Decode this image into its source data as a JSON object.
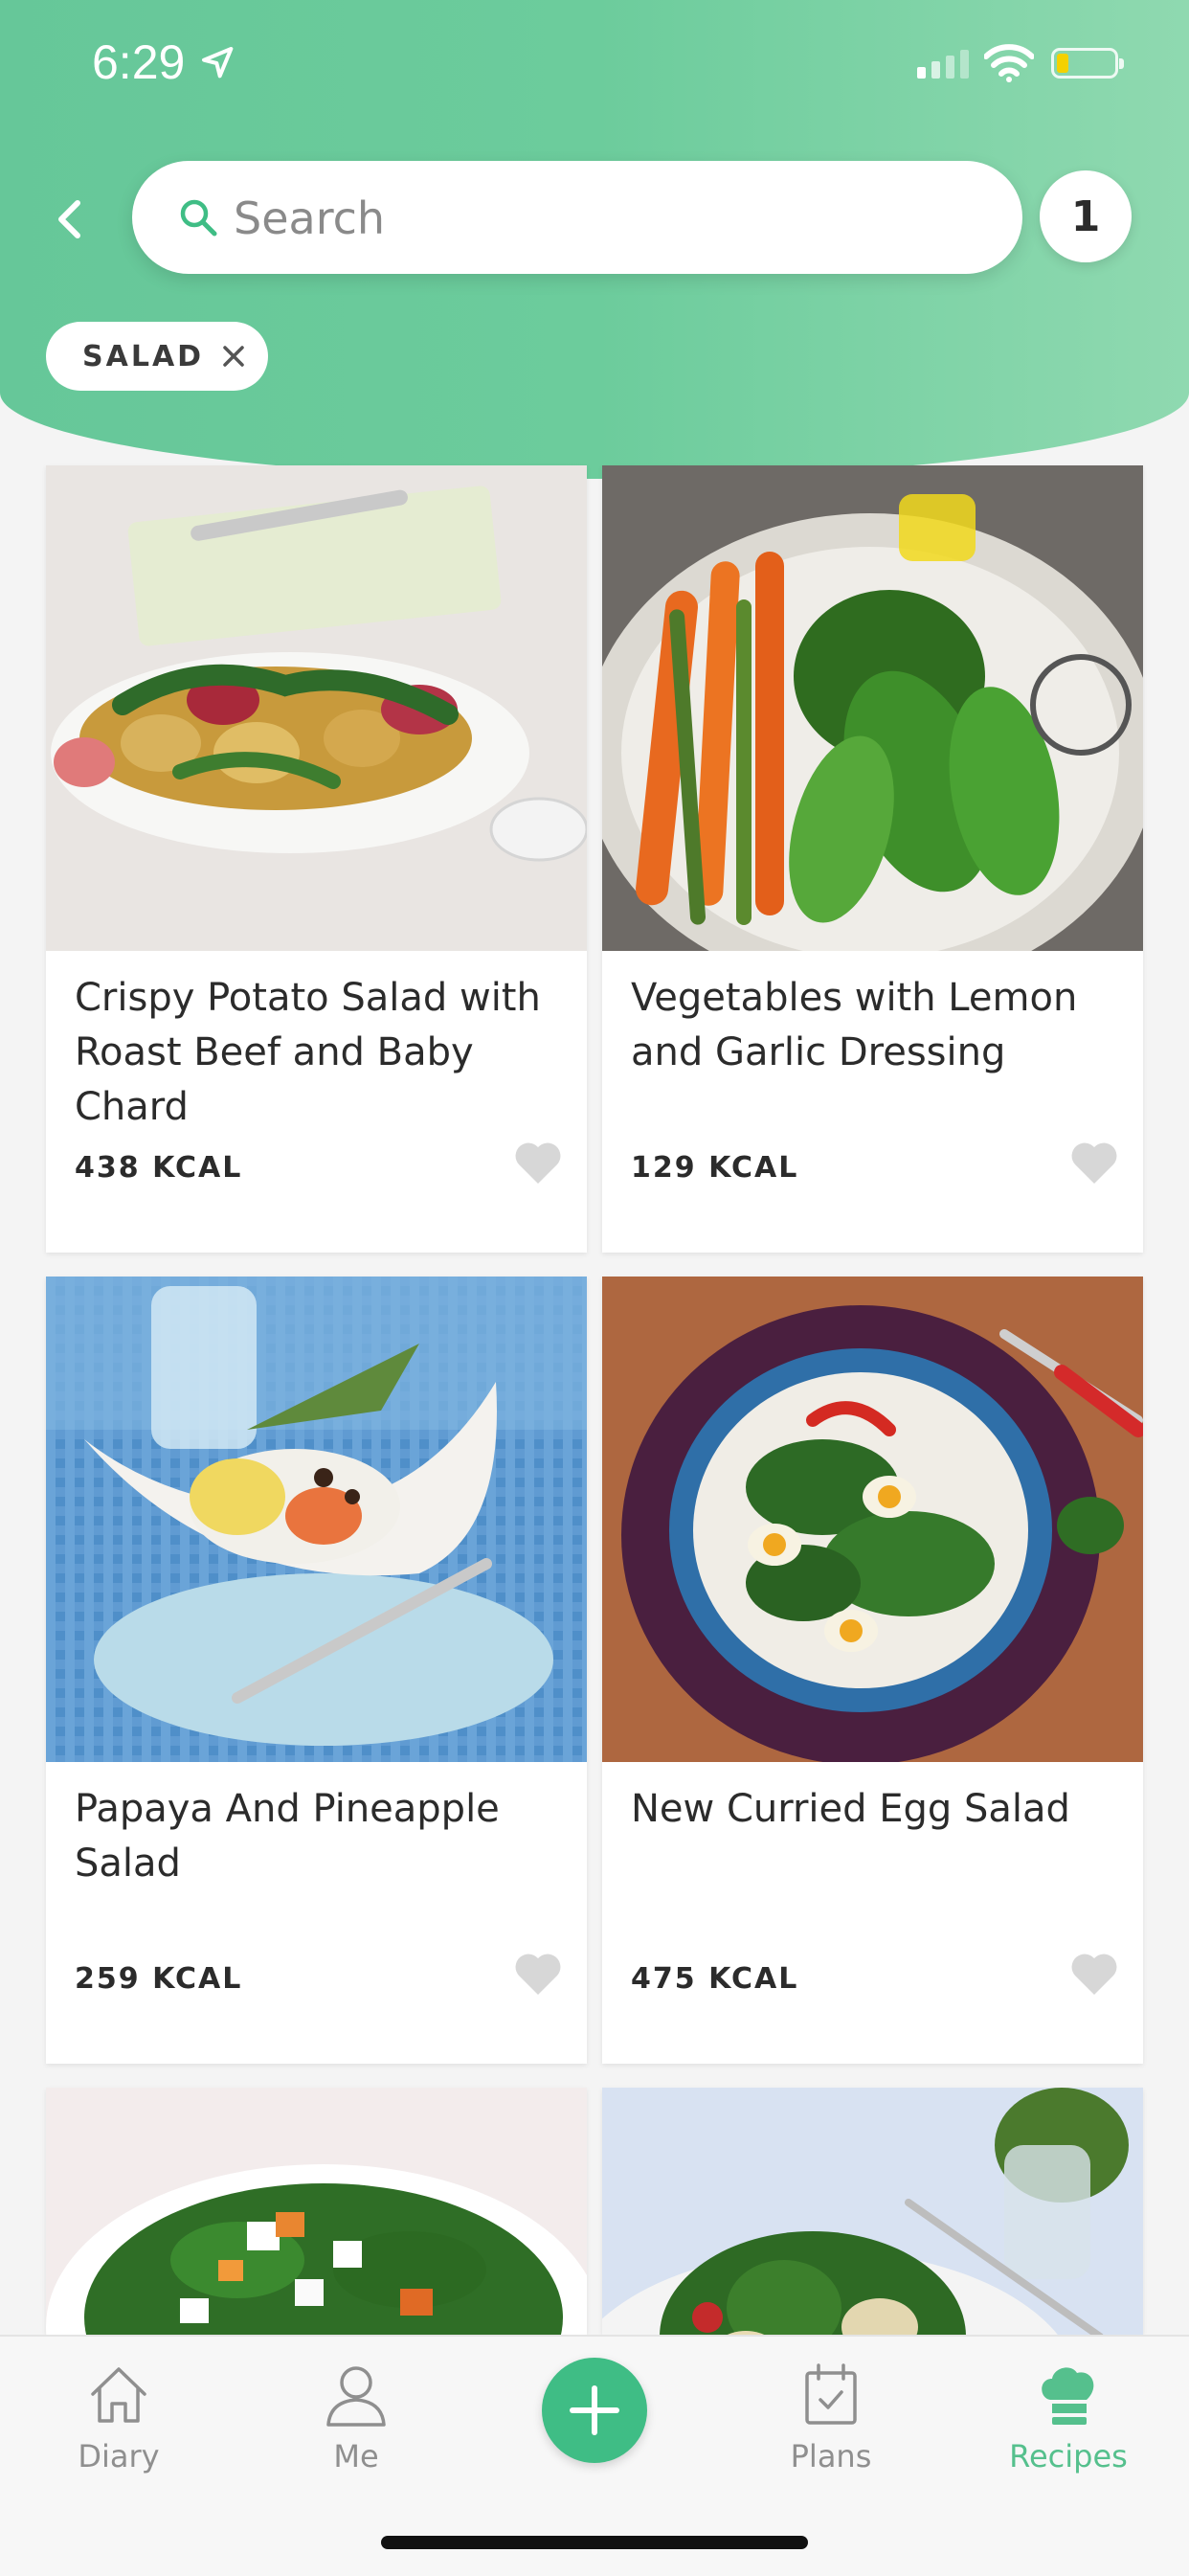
{
  "status_bar": {
    "time": "6:29"
  },
  "search": {
    "placeholder": "Search",
    "filter_count": "1"
  },
  "filters": {
    "active_chip": "SALAD"
  },
  "colors": {
    "accent": "#3fbd85",
    "header": "#6ccc9c",
    "active_tab": "#55c08d"
  },
  "recipes": [
    {
      "title": "Crispy Potato Salad with Roast Beef and Baby Chard",
      "kcal": "438 KCAL",
      "image": "potato-salad-photo"
    },
    {
      "title": "Vegetables with Lemon and Garlic Dressing",
      "kcal": "129 KCAL",
      "image": "vegetables-photo"
    },
    {
      "title": "Papaya And Pineapple Salad",
      "kcal": "259 KCAL",
      "image": "papaya-salad-photo"
    },
    {
      "title": "New Curried Egg Salad",
      "kcal": "475 KCAL",
      "image": "egg-salad-photo"
    },
    {
      "title": "",
      "kcal": "",
      "image": "feta-salad-photo"
    },
    {
      "title": "",
      "kcal": "",
      "image": "pasta-salad-photo"
    }
  ],
  "tabbar": {
    "items": [
      {
        "label": "Diary",
        "icon": "house-icon"
      },
      {
        "label": "Me",
        "icon": "person-icon"
      },
      {
        "label": "",
        "icon": "plus-icon"
      },
      {
        "label": "Plans",
        "icon": "calendar-check-icon"
      },
      {
        "label": "Recipes",
        "icon": "chef-hat-icon",
        "active": true
      }
    ]
  }
}
